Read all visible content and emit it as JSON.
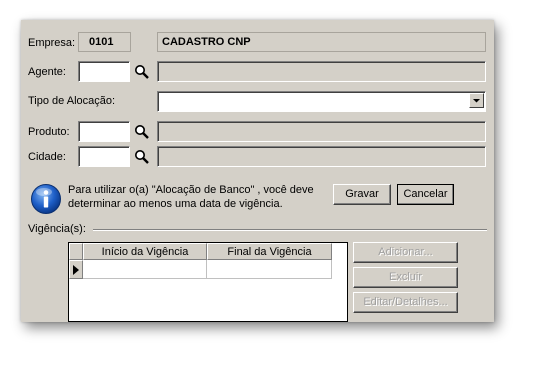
{
  "empresa": {
    "label": "Empresa:",
    "code": "0101",
    "name": "CADASTRO CNP"
  },
  "agente": {
    "label": "Agente:",
    "value": "",
    "description": ""
  },
  "tipo_alocacao": {
    "label": "Tipo de Alocação:",
    "selected": ""
  },
  "produto": {
    "label": "Produto:",
    "value": "",
    "description": ""
  },
  "cidade": {
    "label": "Cidade:",
    "value": "",
    "description": ""
  },
  "info": {
    "line1": "Para utilizar o(a) \"Alocação de Banco\" , você deve",
    "line2": "determinar ao menos uma data de vigência."
  },
  "buttons": {
    "gravar": "Gravar",
    "cancelar": "Cancelar",
    "adicionar": "Adicionar...",
    "excluir": "Excluir",
    "editar": "Editar/Detalhes..."
  },
  "vigencias": {
    "label": "Vigência(s):",
    "columns": [
      "Início da Vigência",
      "Final da Vigência"
    ],
    "rows": [
      [
        "",
        ""
      ]
    ]
  },
  "icons": {
    "lookup": "magnifier-icon",
    "info": "info-icon",
    "dropdown": "chevron-down-icon",
    "row_pointer": "row-indicator-icon"
  }
}
